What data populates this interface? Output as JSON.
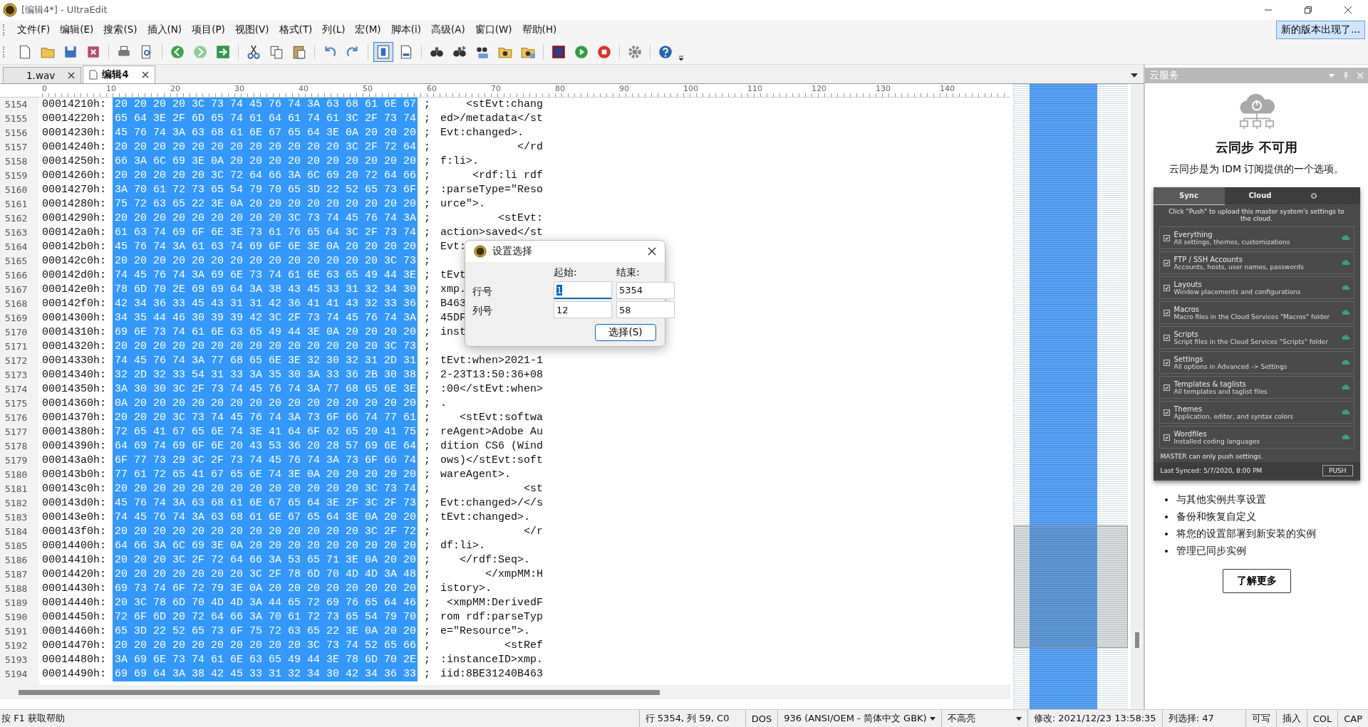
{
  "window": {
    "title": "[编辑4*] - UltraEdit"
  },
  "menu": [
    "文件(F)",
    "编辑(E)",
    "搜索(S)",
    "插入(N)",
    "项目(P)",
    "视图(V)",
    "格式(T)",
    "列(L)",
    "宏(M)",
    "脚本(i)",
    "高级(A)",
    "窗口(W)",
    "帮助(H)"
  ],
  "update_notice": "新的版本出现了...",
  "toolbar": {
    "column_mode": true
  },
  "tabs": [
    {
      "label": "1.wav",
      "selected": false
    },
    {
      "label": "编辑4",
      "selected": true
    }
  ],
  "ruler": [
    "0",
    "10",
    "20",
    "30",
    "40",
    "50",
    "60",
    "70",
    "80",
    "90",
    "100",
    "110",
    "120",
    "130",
    "140"
  ],
  "rows": [
    {
      "num": "5154",
      "addr": "00014210h:",
      "hex": "20 20 20 20 3C 73 74 45 76 74 3A 63 68 61 6E 67",
      "sep": ";",
      "text": "    <stEvt:chang",
      "selected": true
    },
    {
      "num": "5155",
      "addr": "00014220h:",
      "hex": "65 64 3E 2F 6D 65 74 61 64 61 74 61 3C 2F 73 74",
      "sep": ";",
      "text": "ed>/metadata</st",
      "selected": true
    },
    {
      "num": "5156",
      "addr": "00014230h:",
      "hex": "45 76 74 3A 63 68 61 6E 67 65 64 3E 0A 20 20 20",
      "sep": ";",
      "text": "Evt:changed>.",
      "selected": true
    },
    {
      "num": "5157",
      "addr": "00014240h:",
      "hex": "20 20 20 20 20 20 20 20 20 20 20 20 3C 2F 72 64",
      "sep": ";",
      "text": "            </rd",
      "selected": true
    },
    {
      "num": "5158",
      "addr": "00014250h:",
      "hex": "66 3A 6C 69 3E 0A 20 20 20 20 20 20 20 20 20 20",
      "sep": ";",
      "text": "f:li>.",
      "selected": true
    },
    {
      "num": "5159",
      "addr": "00014260h:",
      "hex": "20 20 20 20 20 3C 72 64 66 3A 6C 69 20 72 64 66",
      "sep": ";",
      "text": "     <rdf:li rdf",
      "selected": true
    },
    {
      "num": "5160",
      "addr": "00014270h:",
      "hex": "3A 70 61 72 73 65 54 79 70 65 3D 22 52 65 73 6F",
      "sep": ";",
      "text": ":parseType=\"Reso",
      "selected": true
    },
    {
      "num": "5161",
      "addr": "00014280h:",
      "hex": "75 72 63 65 22 3E 0A 20 20 20 20 20 20 20 20 20",
      "sep": ";",
      "text": "urce\">.",
      "selected": true
    },
    {
      "num": "5162",
      "addr": "00014290h:",
      "hex": "20 20 20 20 20 20 20 20 20 3C 73 74 45 76 74 3A",
      "sep": ";",
      "text": "         <stEvt:",
      "selected": true
    },
    {
      "num": "5163",
      "addr": "000142a0h:",
      "hex": "61 63 74 69 6F 6E 3E 73 61 76 65 64 3C 2F 73 74",
      "sep": ";",
      "text": "action>saved</st",
      "selected": true
    },
    {
      "num": "5164",
      "addr": "000142b0h:",
      "hex": "45 76 74 3A 61 63 74 69 6F 6E 3E 0A 20 20 20 20",
      "sep": ";",
      "text": "Evt:",
      "selected": true
    },
    {
      "num": "5165",
      "addr": "000142c0h:",
      "hex": "20 20 20 20 20 20 20 20 20 20 20 20 20 20 3C 73",
      "sep": ";",
      "selected": true
    },
    {
      "num": "5166",
      "addr": "000142d0h:",
      "hex": "74 45 76 74 3A 69 6E 73 74 61 6E 63 65 49 44 3E",
      "sep": ";",
      "text": "tEvt",
      "selected": true
    },
    {
      "num": "5167",
      "addr": "000142e0h:",
      "hex": "78 6D 70 2E 69 69 64 3A 38 43 45 33 31 32 34 30",
      "sep": ";",
      "text": "xmp.",
      "selected": true
    },
    {
      "num": "5168",
      "addr": "000142f0h:",
      "hex": "42 34 36 33 45 43 31 31 42 36 41 41 43 32 33 36",
      "sep": ";",
      "text": "B463",
      "selected": true
    },
    {
      "num": "5169",
      "addr": "00014300h:",
      "hex": "34 35 44 46 30 39 39 42 3C 2F 73 74 45 76 74 3A",
      "sep": ";",
      "text": "45DF",
      "selected": true
    },
    {
      "num": "5170",
      "addr": "00014310h:",
      "hex": "69 6E 73 74 61 6E 63 65 49 44 3E 0A 20 20 20 20",
      "sep": ";",
      "text": "inst",
      "selected": true
    },
    {
      "num": "5171",
      "addr": "00014320h:",
      "hex": "20 20 20 20 20 20 20 20 20 20 20 20 20 20 3C 73",
      "sep": ";",
      "selected": true
    },
    {
      "num": "5172",
      "addr": "00014330h:",
      "hex": "74 45 76 74 3A 77 68 65 6E 3E 32 30 32 31 2D 31",
      "sep": ";",
      "text": "tEvt:when>2021-1",
      "selected": true
    },
    {
      "num": "5173",
      "addr": "00014340h:",
      "hex": "32 2D 32 33 54 31 33 3A 35 30 3A 33 36 2B 30 38",
      "sep": ";",
      "text": "2-23T13:50:36+08",
      "selected": true
    },
    {
      "num": "5174",
      "addr": "00014350h:",
      "hex": "3A 30 30 3C 2F 73 74 45 76 74 3A 77 68 65 6E 3E",
      "sep": ";",
      "text": ":00</stEvt:when>",
      "selected": true
    },
    {
      "num": "5175",
      "addr": "00014360h:",
      "hex": "0A 20 20 20 20 20 20 20 20 20 20 20 20 20 20 20",
      "sep": ";",
      "text": ".",
      "selected": true
    },
    {
      "num": "5176",
      "addr": "00014370h:",
      "hex": "20 20 20 3C 73 74 45 76 74 3A 73 6F 66 74 77 61",
      "sep": ";",
      "text": "   <stEvt:softwa",
      "selected": true
    },
    {
      "num": "5177",
      "addr": "00014380h:",
      "hex": "72 65 41 67 65 6E 74 3E 41 64 6F 62 65 20 41 75",
      "sep": ";",
      "text": "reAgent>Adobe Au",
      "selected": true
    },
    {
      "num": "5178",
      "addr": "00014390h:",
      "hex": "64 69 74 69 6F 6E 20 43 53 36 20 28 57 69 6E 64",
      "sep": ";",
      "text": "dition CS6 (Wind",
      "selected": true
    },
    {
      "num": "5179",
      "addr": "000143a0h:",
      "hex": "6F 77 73 29 3C 2F 73 74 45 76 74 3A 73 6F 66 74",
      "sep": ";",
      "text": "ows)</stEvt:soft",
      "selected": true
    },
    {
      "num": "5180",
      "addr": "000143b0h:",
      "hex": "77 61 72 65 41 67 65 6E 74 3E 0A 20 20 20 20 20",
      "sep": ";",
      "text": "wareAgent>.",
      "selected": true
    },
    {
      "num": "5181",
      "addr": "000143c0h:",
      "hex": "20 20 20 20 20 20 20 20 20 20 20 20 20 3C 73 74",
      "sep": ";",
      "text": "             <st",
      "selected": true
    },
    {
      "num": "5182",
      "addr": "000143d0h:",
      "hex": "45 76 74 3A 63 68 61 6E 67 65 64 3E 2F 3C 2F 73",
      "sep": ";",
      "text": "Evt:changed>/</s",
      "selected": true
    },
    {
      "num": "5183",
      "addr": "000143e0h:",
      "hex": "74 45 76 74 3A 63 68 61 6E 67 65 64 3E 0A 20 20",
      "sep": ";",
      "text": "tEvt:changed>.",
      "selected": true
    },
    {
      "num": "5184",
      "addr": "000143f0h:",
      "hex": "20 20 20 20 20 20 20 20 20 20 20 20 20 3C 2F 72",
      "sep": ";",
      "text": "             </r",
      "selected": true
    },
    {
      "num": "5185",
      "addr": "00014400h:",
      "hex": "64 66 3A 6C 69 3E 0A 20 20 20 20 20 20 20 20 20",
      "sep": ";",
      "text": "df:li>.",
      "selected": true
    },
    {
      "num": "5186",
      "addr": "00014410h:",
      "hex": "20 20 20 3C 2F 72 64 66 3A 53 65 71 3E 0A 20 20",
      "sep": ";",
      "text": "   </rdf:Seq>.",
      "selected": true
    },
    {
      "num": "5187",
      "addr": "00014420h:",
      "hex": "20 20 20 20 20 20 20 3C 2F 78 6D 70 4D 4D 3A 48",
      "sep": ";",
      "text": "       </xmpMM:H",
      "selected": true
    },
    {
      "num": "5188",
      "addr": "00014430h:",
      "hex": "69 73 74 6F 72 79 3E 0A 20 20 20 20 20 20 20 20",
      "sep": ";",
      "text": "istory>.",
      "selected": true
    },
    {
      "num": "5189",
      "addr": "00014440h:",
      "hex": "20 3C 78 6D 70 4D 4D 3A 44 65 72 69 76 65 64 46",
      "sep": ";",
      "text": " <xmpMM:DerivedF",
      "selected": true
    },
    {
      "num": "5190",
      "addr": "00014450h:",
      "hex": "72 6F 6D 20 72 64 66 3A 70 61 72 73 65 54 79 70",
      "sep": ";",
      "text": "rom rdf:parseTyp",
      "selected": true
    },
    {
      "num": "5191",
      "addr": "00014460h:",
      "hex": "65 3D 22 52 65 73 6F 75 72 63 65 22 3E 0A 20 20",
      "sep": ";",
      "text": "e=\"Resource\">.",
      "selected": true
    },
    {
      "num": "5192",
      "addr": "00014470h:",
      "hex": "20 20 20 20 20 20 20 20 20 20 3C 73 74 52 65 66",
      "sep": ";",
      "text": "          <stRef",
      "selected": true
    },
    {
      "num": "5193",
      "addr": "00014480h:",
      "hex": "3A 69 6E 73 74 61 6E 63 65 49 44 3E 78 6D 70 2E",
      "sep": ";",
      "text": ":instanceID>xmp.",
      "selected": true
    },
    {
      "num": "5194",
      "addr": "00014490h:",
      "hex": "69 69 64 3A 38 42 45 33 31 32 34 30 42 34 36 33",
      "sep": ";",
      "text": "iid:8BE31240B463",
      "selected": true
    }
  ],
  "dialog": {
    "title": "设置选择",
    "col_start": "起始:",
    "col_end": "结束:",
    "fields": [
      {
        "label": "行号",
        "start": "1",
        "end": "5354",
        "start_focused": true
      },
      {
        "label": "列号",
        "start": "12",
        "end": "58",
        "start_focused": false
      }
    ],
    "button": "选择(S)"
  },
  "cloud_panel": {
    "title": "云服务",
    "heading": "云同步 不可用",
    "description": "云同步是为 IDM 订阅提供的一个选项。",
    "preview": {
      "tabs": [
        {
          "label": "Sync",
          "selected": true
        },
        {
          "label": "Cloud",
          "selected": false
        }
      ],
      "intro": "Click \"Push\" to upload this master system's settings to the cloud.",
      "items": [
        {
          "title": "Everything",
          "desc": "All settings, themes, customizations",
          "checked": true
        },
        {
          "title": "FTP / SSH Accounts",
          "desc": "Accounts, hosts, user names, passwords",
          "checked": true
        },
        {
          "title": "Layouts",
          "desc": "Window placements and configurations",
          "checked": true
        },
        {
          "title": "Macros",
          "desc": "Macro files in the Cloud Services \"Macros\" folder",
          "checked": true
        },
        {
          "title": "Scripts",
          "desc": "Script files in the Cloud Services \"Scripts\" folder",
          "checked": true
        },
        {
          "title": "Settings",
          "desc": "All options in Advanced -> Settings",
          "checked": true
        },
        {
          "title": "Templates & taglists",
          "desc": "All templates and taglist files",
          "checked": true
        },
        {
          "title": "Themes",
          "desc": "Application, editor, and syntax colors",
          "checked": true
        },
        {
          "title": "Wordfiles",
          "desc": "Installed coding languages",
          "checked": true
        }
      ],
      "master_note": "MASTER can only push settings.",
      "last_synced": "Last Synced: 5/7/2020, 8:00 PM",
      "push": "PUSH"
    },
    "bullets": [
      "与其他实例共享设置",
      "备份和恢复自定义",
      "将您的设置部署到新安装的实例",
      "管理已同步实例"
    ],
    "learn_more": "了解更多"
  },
  "status_bar": {
    "help": "按 F1 获取帮助",
    "position": "行 5354, 列 59, C0",
    "line_ending": "DOS",
    "encoding": "936  (ANSI/OEM - 简体中文 GBK)",
    "highlight": "不高亮",
    "modified": "修改:  2021/12/23 13:58:35",
    "column_select": "列选择: 47",
    "writable": "可写",
    "insert": "插入",
    "col": "COL",
    "cap": "CAP"
  }
}
